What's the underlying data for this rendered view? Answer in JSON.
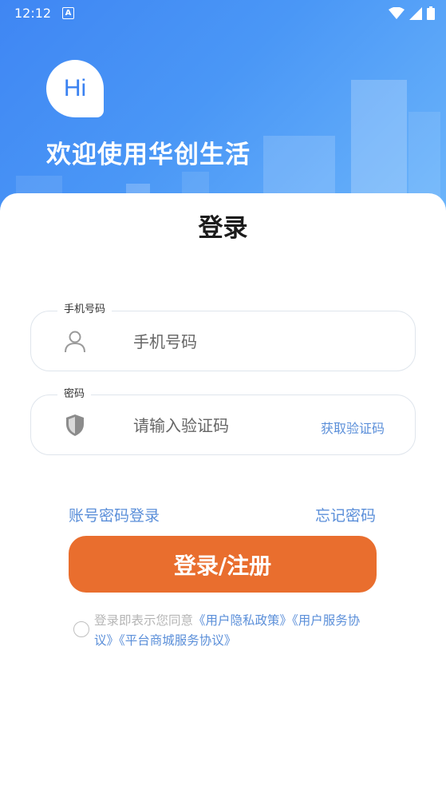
{
  "status_bar": {
    "time": "12:12",
    "indicator": "A"
  },
  "header": {
    "bubble_text": "Hi",
    "welcome": "欢迎使用华创生活"
  },
  "login": {
    "title": "登录",
    "phone": {
      "label": "手机号码",
      "placeholder": "手机号码",
      "icon": "user-icon"
    },
    "code": {
      "label": "密码",
      "placeholder": "请输入验证码",
      "icon": "shield-icon",
      "get_code": "获取验证码"
    },
    "account_login": "账号密码登录",
    "forgot_password": "忘记密码",
    "submit": "登录/注册",
    "agreement": {
      "prefix": "登录即表示您同意",
      "privacy": "《用户隐私政策》",
      "service": "《用户服务协议》",
      "mall": "《平台商城服务协议》"
    }
  },
  "colors": {
    "hero": "#4a97f6",
    "accent": "#e96e2e",
    "link": "#5b8fd9"
  }
}
